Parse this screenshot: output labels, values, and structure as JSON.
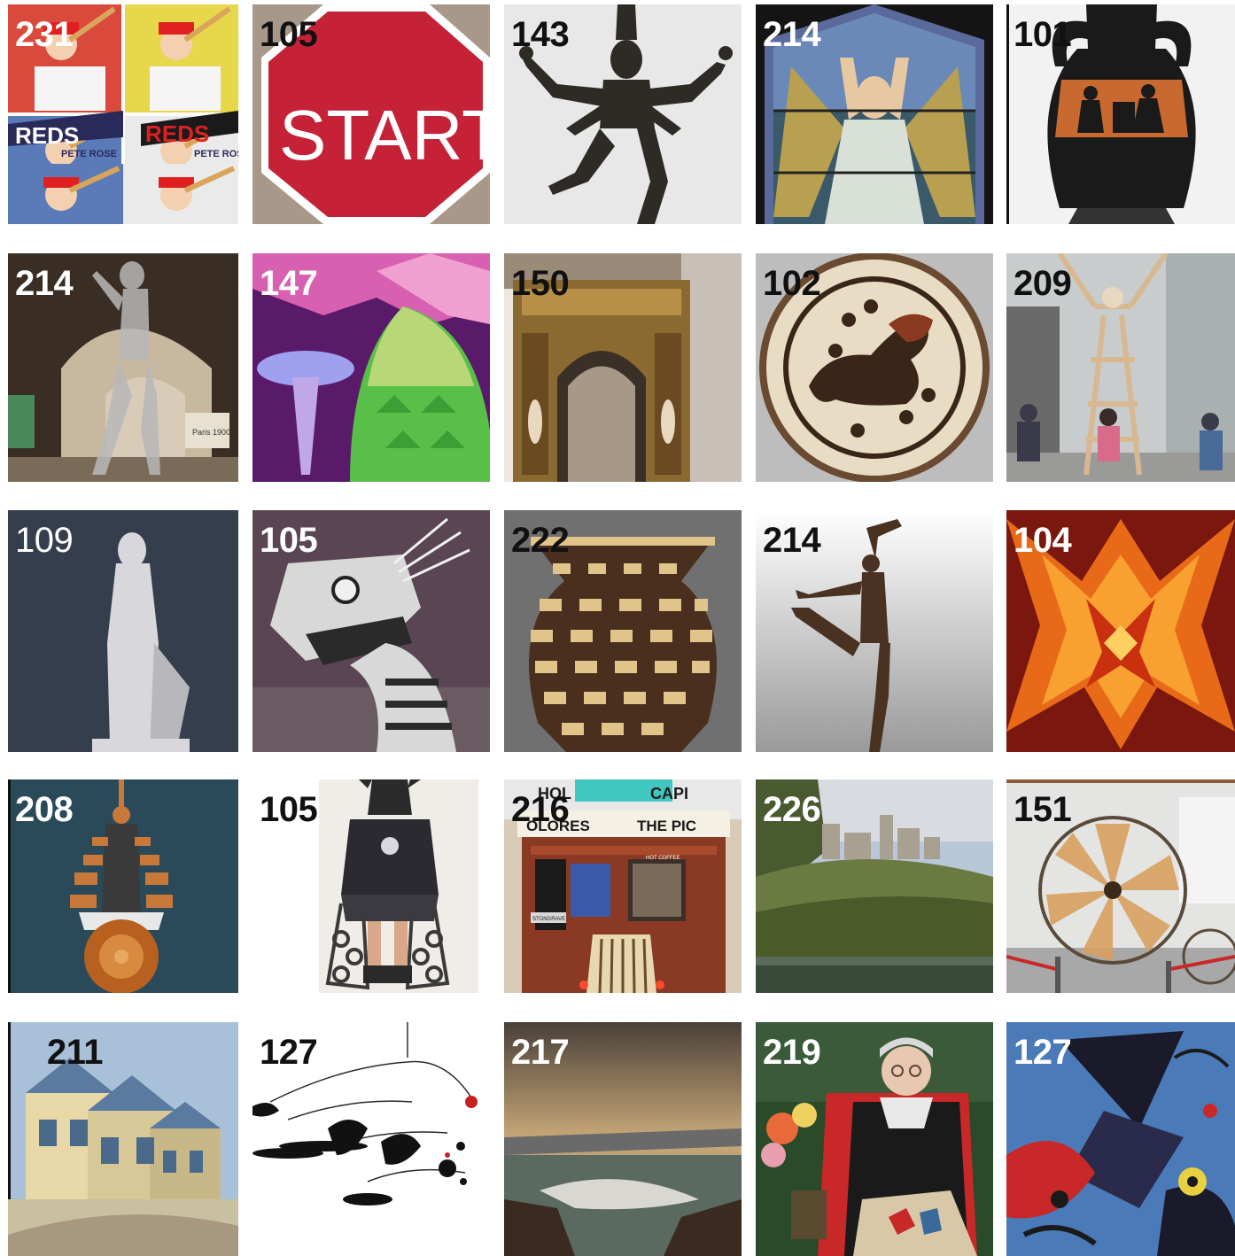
{
  "tiles": [
    {
      "number": "231",
      "icon": "pop-art-baseball-cards-icon",
      "bg": "#d94a3c",
      "label_color": "white",
      "text": [
        "REDS",
        "REDS",
        "PETE ROSE",
        "PETE ROSE"
      ]
    },
    {
      "number": "105",
      "icon": "start-sign-icon",
      "bg": "#c52238",
      "label_color": "black",
      "text": [
        "START"
      ]
    },
    {
      "number": "143",
      "icon": "dancing-bronze-deity-icon",
      "bg": "#e8e8e8",
      "label_color": "black"
    },
    {
      "number": "214",
      "icon": "stained-glass-angel-icon",
      "bg": "#3a4f7a",
      "label_color": "white"
    },
    {
      "number": "101",
      "icon": "greek-amphora-icon",
      "bg": "#f2f2f2",
      "label_color": "black"
    },
    {
      "number": "214",
      "icon": "glass-figure-sculpture-icon",
      "bg": "#6b5844",
      "label_color": "white",
      "text": [
        "Paris 1900"
      ]
    },
    {
      "number": "147",
      "icon": "origami-mushroom-installation-icon",
      "bg": "#7a2a8a",
      "label_color": "white"
    },
    {
      "number": "150",
      "icon": "ornate-gilded-arch-icon",
      "bg": "#5a4a38",
      "label_color": "black"
    },
    {
      "number": "102",
      "icon": "lion-painted-plate-icon",
      "bg": "#bdbdbd",
      "label_color": "black"
    },
    {
      "number": "209",
      "icon": "wooden-figure-sculpture-icon",
      "bg": "#b7bcbc",
      "label_color": "black"
    },
    {
      "number": "109",
      "icon": "marble-venus-statue-icon",
      "bg": "#3c4654",
      "label_color": "white"
    },
    {
      "number": "105",
      "icon": "dragon-puppet-icon",
      "bg": "#5a4652",
      "label_color": "white"
    },
    {
      "number": "222",
      "icon": "woven-basket-vase-icon",
      "bg": "#8c8c8c",
      "label_color": "black"
    },
    {
      "number": "214",
      "icon": "bronze-dancer-statue-icon",
      "bg": "#e4e4e4",
      "label_color": "black"
    },
    {
      "number": "104",
      "icon": "glowing-star-installation-icon",
      "bg": "#8a1c14",
      "label_color": "white"
    },
    {
      "number": "208",
      "icon": "copper-pot-robot-sculpture-icon",
      "bg": "#2a4a5a",
      "label_color": "white"
    },
    {
      "number": "105",
      "icon": "armored-costume-figure-icon",
      "bg": "#ffffff",
      "label_color": "black"
    },
    {
      "number": "216",
      "icon": "theater-marquee-truck-icon",
      "bg": "#5a2a1e",
      "label_color": "black",
      "text": [
        "OLORES",
        "THE PIC",
        "HOL",
        "CAPI",
        "STONGRAVE",
        "HOT COFFEE"
      ]
    },
    {
      "number": "226",
      "icon": "castle-landscape-painting-icon",
      "bg": "#7a8a5a",
      "label_color": "white"
    },
    {
      "number": "151",
      "icon": "spinning-wheel-bicycle-icon",
      "bg": "#d8d8d8",
      "label_color": "black"
    },
    {
      "number": "211",
      "icon": "houses-painting-icon",
      "bg": "#6a8aa8",
      "label_color": "black"
    },
    {
      "number": "127",
      "icon": "hanging-mobile-icon",
      "bg": "#ffffff",
      "label_color": "black"
    },
    {
      "number": "217",
      "icon": "stormy-coast-painting-icon",
      "bg": "#6a6058",
      "label_color": "white"
    },
    {
      "number": "219",
      "icon": "woman-portrait-painting-icon",
      "bg": "#3a5a3a",
      "label_color": "white"
    },
    {
      "number": "127",
      "icon": "abstract-surrealist-painting-icon",
      "bg": "#4a7ab8",
      "label_color": "white"
    }
  ]
}
